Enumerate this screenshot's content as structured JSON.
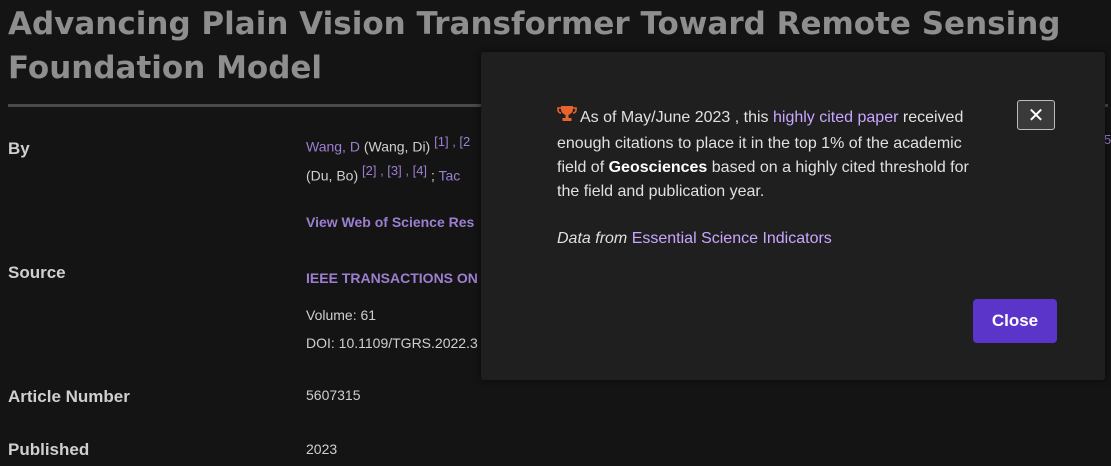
{
  "record": {
    "title": "Advancing Plain Vision Transformer Toward Remote Sensing Foundation Model",
    "by_label": "By",
    "authors": {
      "a1_link": "Wang, D",
      "a1_full": "(Wang, Di)",
      "a1_ref1": "[1] , [2",
      "a2_full": "(Du, Bo)",
      "a2_refs": "[2] , [3] , [4]",
      "sep": ";",
      "a3_partial": "Tac",
      "edge_ref": "5"
    },
    "view_wos": "View Web of Science Res",
    "source_label": "Source",
    "source_journal": "IEEE TRANSACTIONS ON",
    "volume": "Volume: 61",
    "doi": "DOI: 10.1109/TGRS.2022.3",
    "article_number_label": "Article Number",
    "article_number": "5607315",
    "published_label": "Published",
    "published": "2023"
  },
  "modal": {
    "icon": "trophy-icon",
    "line_prefix": "As of May/June 2023 , this",
    "highly_cited": "highly cited paper",
    "line_mid": "received enough citations to place it in the top 1% of the academic field of",
    "field": "Geosciences",
    "line_suffix": "based on a highly cited threshold for the field and publication year.",
    "data_from": "Data from",
    "data_source": "Essential Science Indicators",
    "x_label": "✕",
    "close_label": "Close"
  },
  "colors": {
    "accent": "#5b35c9",
    "link": "#9c7fd0",
    "modal_link": "#c9a6ff",
    "trophy": "#e8642c"
  }
}
